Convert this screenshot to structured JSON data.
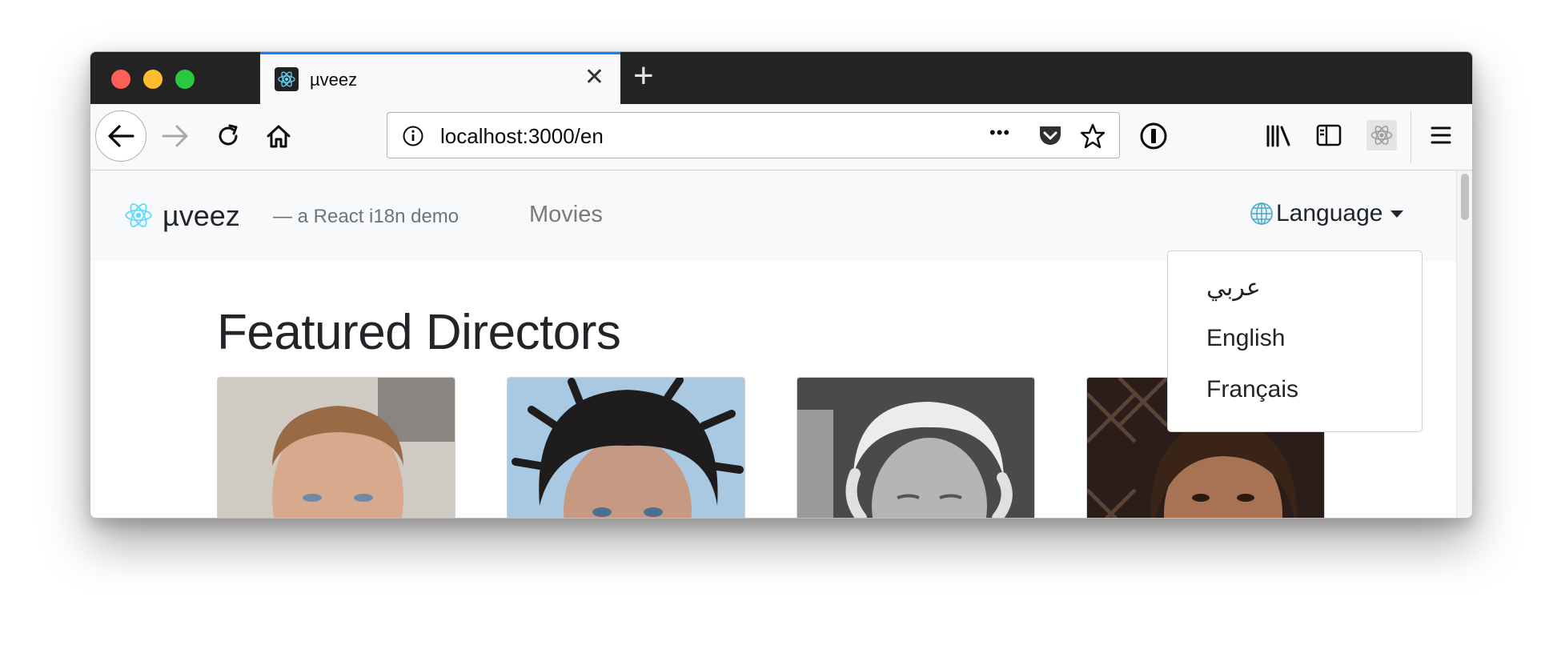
{
  "browser": {
    "tab_title": "µveez",
    "tab_close": "✕",
    "new_tab": "+",
    "url": "localhost:3000/en",
    "url_more": "•••"
  },
  "navbar": {
    "brand": "µveez",
    "tagline": "— a React i18n demo",
    "movies_link": "Movies",
    "language_label": "Language"
  },
  "language_menu": {
    "items": [
      "عربي",
      "English",
      "Français"
    ]
  },
  "main": {
    "heading": "Featured Directors",
    "cards": [
      "director-photo-1",
      "director-photo-2",
      "director-photo-3",
      "director-photo-4"
    ]
  },
  "colors": {
    "react_blue": "#61dafb",
    "tab_accent": "#0a84ff"
  }
}
